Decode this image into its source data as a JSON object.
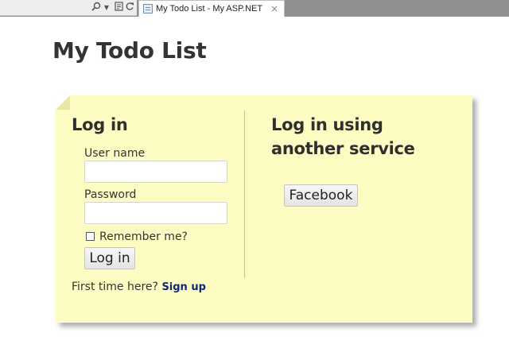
{
  "browser": {
    "toolbar_icons": [
      "search-icon",
      "dropdown-arrow-icon",
      "compatibility-icon",
      "refresh-icon"
    ],
    "tab": {
      "title": "My Todo List - My ASP.NET...",
      "close": "×"
    }
  },
  "page": {
    "title": "My Todo List"
  },
  "login": {
    "heading": "Log in",
    "username_label": "User name",
    "username_value": "",
    "password_label": "Password",
    "password_value": "",
    "remember_label": "Remember me?",
    "remember_checked": false,
    "submit_label": "Log in",
    "first_time_text": "First time here?",
    "signup_label": "Sign up"
  },
  "external": {
    "heading_line1": "Log in using",
    "heading_line2": "another service",
    "providers": [
      "Facebook"
    ]
  },
  "colors": {
    "note_background": "#fdfcc2",
    "link": "#0b2a6f"
  }
}
